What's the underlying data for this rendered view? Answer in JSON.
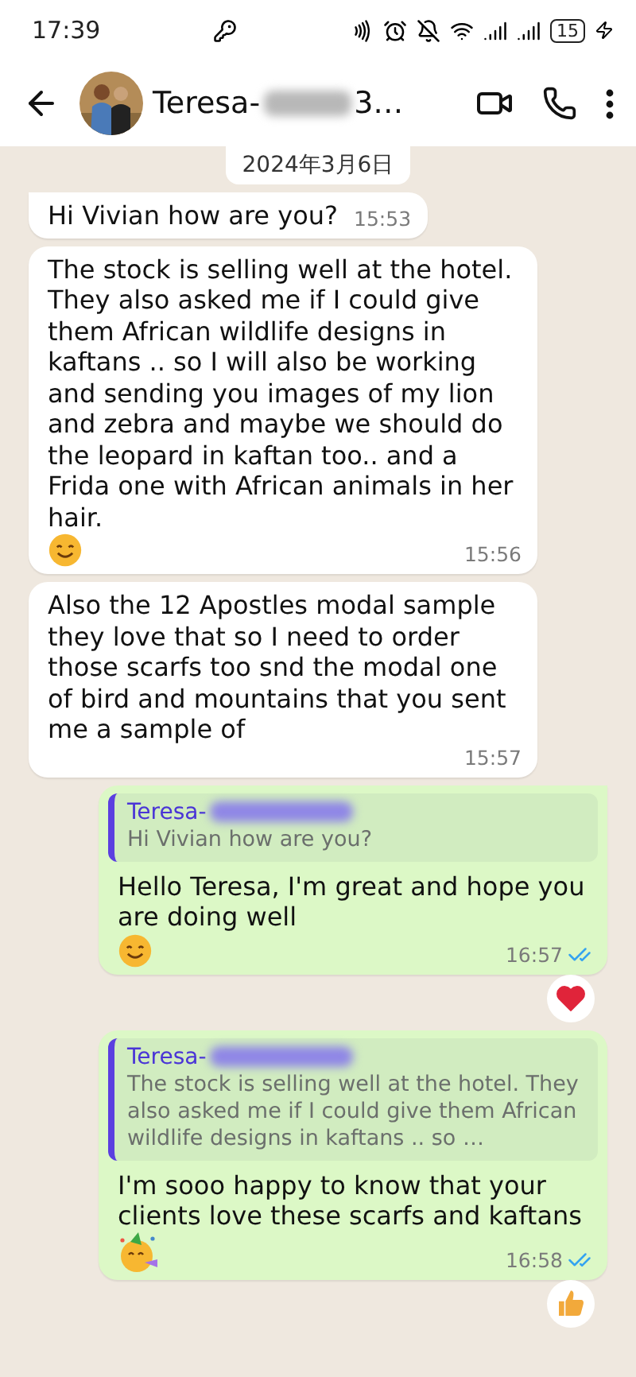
{
  "status_bar": {
    "time": "17:39",
    "battery": "15"
  },
  "header": {
    "name": "Teresa-",
    "name_tail": "3…"
  },
  "date_chip": "2024年3月6日",
  "messages": [
    {
      "kind": "incoming",
      "text": "Hi Vivian how are you?",
      "time": "15:53",
      "tail": true
    },
    {
      "kind": "incoming",
      "text": "The stock is selling well at the hotel. They also asked me if I could give them African wildlife designs in kaftans .. so I will also be working and sending you images of my lion and zebra and maybe we should do the leopard in kaftan too.. and a Frida one with African animals in her hair.",
      "emojis": [
        {
          "kind": "smile"
        }
      ],
      "time": "15:56",
      "tail": false
    },
    {
      "kind": "incoming",
      "text": "Also the 12 Apostles modal sample they love that so I need to order those scarfs too snd the modal one of bird and mountains that you sent me a sample of",
      "time": "15:57",
      "tail": false
    },
    {
      "kind": "outgoing",
      "quote": {
        "author": "Teresa-",
        "text": "Hi Vivian how are you?"
      },
      "text": "Hello Teresa, I'm great and hope you are doing well",
      "emojis": [
        {
          "kind": "smile"
        }
      ],
      "time": "16:57",
      "read": true,
      "reactions": [
        {
          "kind": "heart"
        }
      ],
      "tail": true
    },
    {
      "kind": "outgoing",
      "quote": {
        "author": "Teresa-",
        "text": "The stock is selling well at the hotel. They also asked me if I could give them African wildlife designs in kaftans .. so …"
      },
      "text": "I'm sooo happy to know that your clients love these scarfs and kaftans",
      "emojis": [
        {
          "kind": "party"
        }
      ],
      "time": "16:58",
      "read": true,
      "reactions": [
        {
          "kind": "thumbs"
        }
      ],
      "tail": false
    }
  ]
}
